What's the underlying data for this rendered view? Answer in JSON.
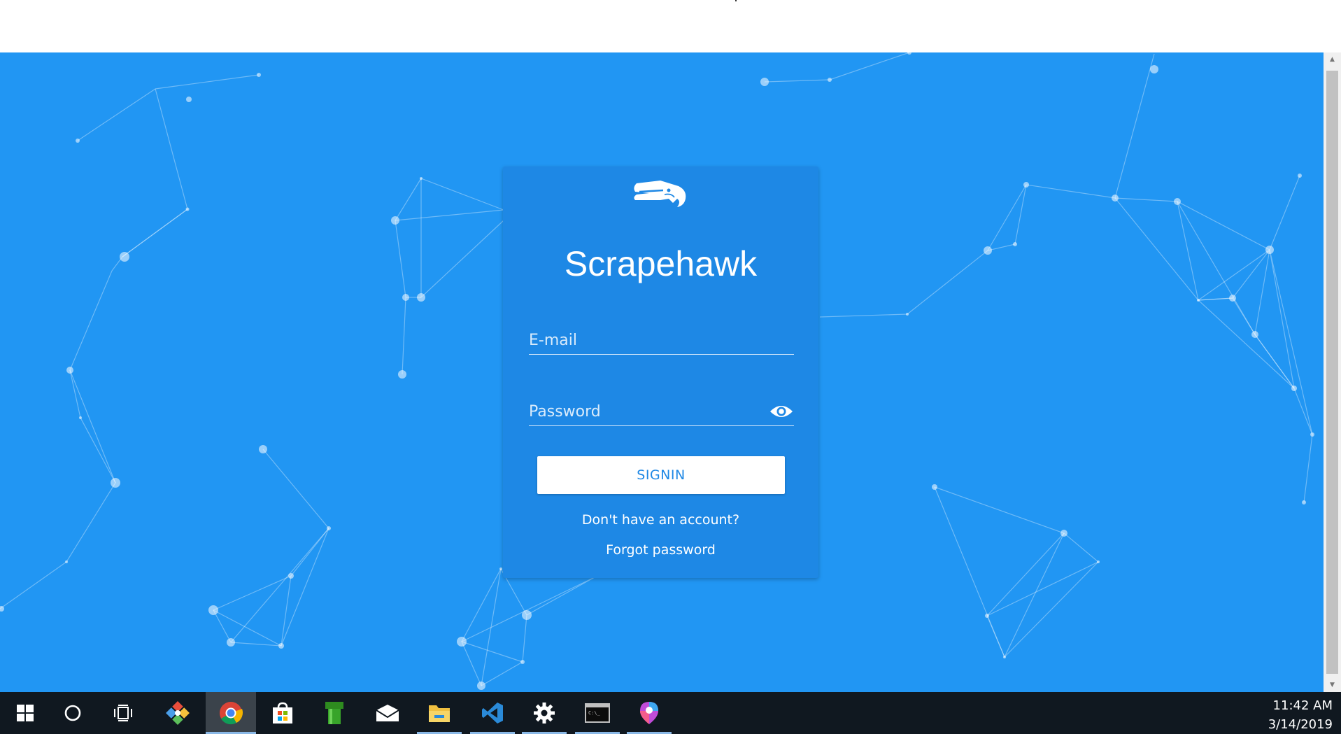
{
  "app": {
    "title": "Scrapehawk",
    "logo_icon": "seahawk-logo-icon"
  },
  "login": {
    "email_placeholder": "E-mail",
    "password_placeholder": "Password",
    "toggle_visibility_icon": "eye-icon",
    "signin_label": "SIGNIN",
    "signup_link": "Don't have an account?",
    "forgot_link": "Forgot password"
  },
  "colors": {
    "background": "#2196f3",
    "card": "#1e88e5",
    "button_text": "#1e88e5",
    "taskbar": "#101820"
  },
  "taskbar": {
    "items": [
      {
        "icon": "windows-start-icon",
        "active": false,
        "running": false
      },
      {
        "icon": "cortana-search-icon",
        "active": false,
        "running": false
      },
      {
        "icon": "task-view-icon",
        "active": false,
        "running": false
      },
      {
        "icon": "git-icon",
        "active": false,
        "running": false
      },
      {
        "icon": "chrome-icon",
        "active": true,
        "running": true
      },
      {
        "icon": "store-icon",
        "active": false,
        "running": false
      },
      {
        "icon": "green-pipe-icon",
        "active": false,
        "running": false
      },
      {
        "icon": "mail-icon",
        "active": false,
        "running": false
      },
      {
        "icon": "file-explorer-icon",
        "active": false,
        "running": true
      },
      {
        "icon": "vscode-icon",
        "active": false,
        "running": true
      },
      {
        "icon": "settings-icon",
        "active": false,
        "running": true
      },
      {
        "icon": "terminal-icon",
        "active": false,
        "running": true
      },
      {
        "icon": "maps-pin-icon",
        "active": false,
        "running": true
      }
    ],
    "time": "11:42 AM",
    "date": "3/14/2019"
  }
}
